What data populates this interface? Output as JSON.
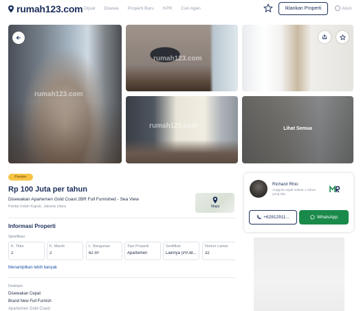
{
  "header": {
    "logo_text": "rumah123.com",
    "nav": [
      "Dijual",
      "Disewa",
      "Properti Baru",
      "KPR",
      "Cari Agen"
    ],
    "cta_label": "Iklankan Properti",
    "account_label": "Akun"
  },
  "gallery": {
    "watermark": "rumah123.com",
    "see_all_label": "Lihat Semua"
  },
  "listing": {
    "badge": "Premier",
    "price": "Rp 100 Juta per tahun",
    "title": "Disewakan Apartemen Gold Coast 2BR Full Furnished - Sea View",
    "location": "Pantai Indah Kapuk, Jakarta Utara",
    "map_label": "Maps"
  },
  "property_info": {
    "section_title": "Informasi Properti",
    "spec_label": "Spesifikasi",
    "specs": [
      {
        "key": "K. Tidur",
        "value": "2"
      },
      {
        "key": "K. Mandi",
        "value": "2"
      },
      {
        "key": "L. Bangunan",
        "value": "62 m²"
      },
      {
        "key": "Tipe Properti",
        "value": "Apartemen"
      },
      {
        "key": "Sertifikat",
        "value": "Lainnya (PPJB..."
      },
      {
        "key": "Nomor Lantai",
        "value": "32"
      }
    ],
    "more_link": "Menampilkan lebih banyak",
    "desc_label": "Deskripsi",
    "desc_lines": [
      "Disewakan Cepat",
      "Brand New Full Furnish",
      "Apartemen Gold Coast"
    ]
  },
  "agent": {
    "name": "Richard Rhio",
    "since": "Anggota sejak sekitar 1 tahun yang lalu",
    "phone_label": "+62812911...",
    "whatsapp_label": "WhatsApp"
  },
  "colors": {
    "brand": "#1b2e5a",
    "whatsapp": "#1a8a4a",
    "premier": "#f6c343"
  }
}
